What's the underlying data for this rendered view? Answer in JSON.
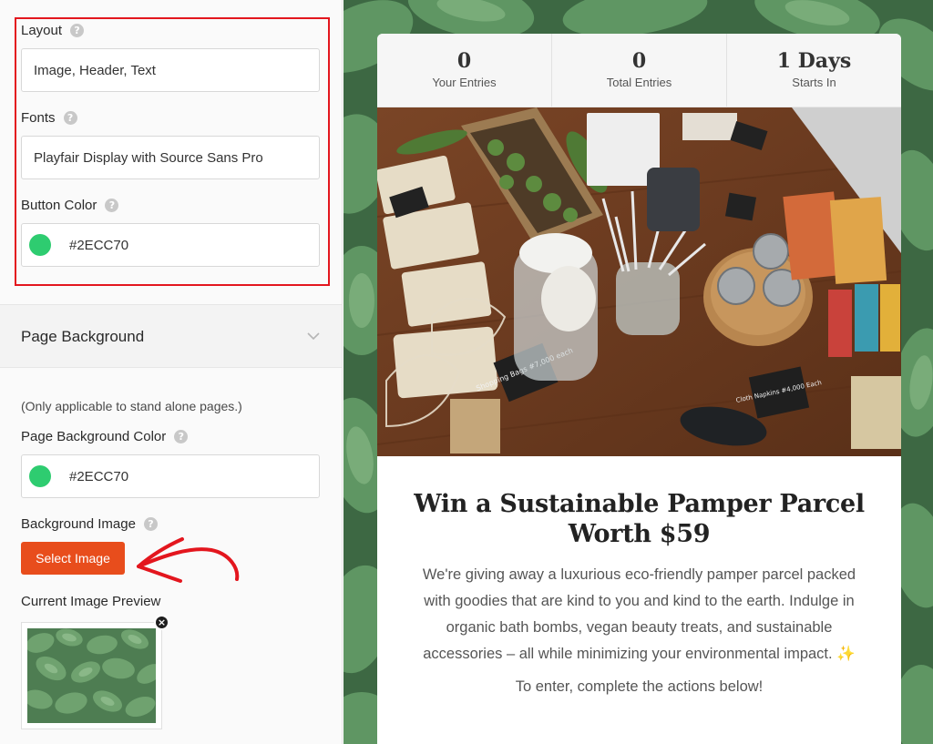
{
  "settings": {
    "layout": {
      "label": "Layout",
      "value": "Image, Header, Text"
    },
    "fonts": {
      "label": "Fonts",
      "value": "Playfair Display with Source Sans Pro"
    },
    "button_color": {
      "label": "Button Color",
      "value": "#2ECC70",
      "swatch": "#2ecc70"
    }
  },
  "page_background": {
    "section_title": "Page Background",
    "note": "(Only applicable to stand alone pages.)",
    "color": {
      "label": "Page Background Color",
      "value": "#2ECC70",
      "swatch": "#2ecc70"
    },
    "image": {
      "label": "Background Image",
      "button_label": "Select Image"
    },
    "preview_label": "Current Image Preview"
  },
  "icons": {
    "help": "?",
    "remove": "×",
    "chevron": "chevron-down-icon"
  },
  "giveaway": {
    "stats": [
      {
        "value": "0",
        "label": "Your Entries"
      },
      {
        "value": "0",
        "label": "Total Entries"
      },
      {
        "value": "1 Days",
        "label": "Starts In"
      }
    ],
    "title": "Win a Sustainable Pamper Parcel Worth $59",
    "description": "We're giving away a luxurious eco-friendly pamper parcel packed with goodies that are kind to you and kind to the earth. Indulge in organic bath bombs, vegan beauty treats, and sustainable accessories – all while minimizing your environmental impact. ✨",
    "cta": "To enter, complete the actions below!"
  },
  "chalk_signs": [
    "Shopping Bags #7,000 each",
    "Cloth Napkins #4,000 Each"
  ],
  "colors": {
    "accent_button": "#e84d1c",
    "highlight_border": "#e3161e",
    "swatch_green": "#2ecc70"
  }
}
